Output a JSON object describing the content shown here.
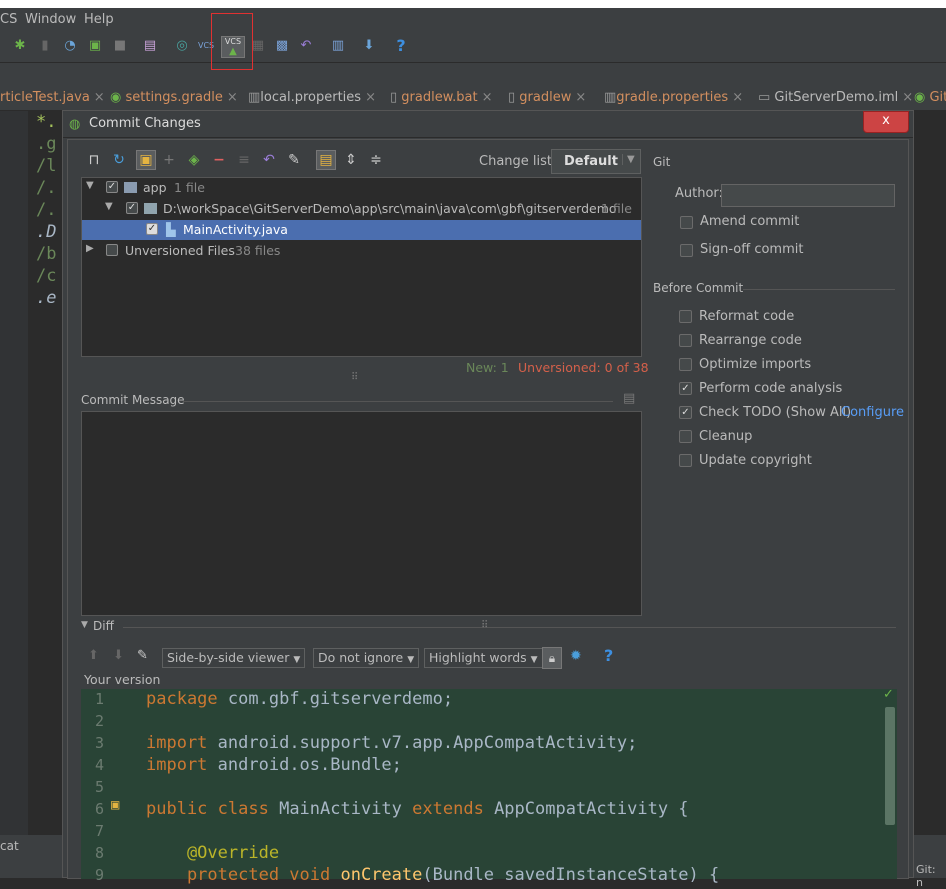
{
  "menu": {
    "items": [
      "CS",
      "Window",
      "Help"
    ]
  },
  "toolbar": {
    "icons": [
      "debug-icon",
      "attach-debugger-icon",
      "coverage-icon",
      "profile-icon",
      "stop-icon",
      "sdk-manager-icon",
      "sync-icon",
      "vcs-update-icon",
      "vcs-commit-icon",
      "project-structure-icon",
      "avd-manager-icon",
      "revert-icon",
      "project-view-icon",
      "android-monitor-icon",
      "help-icon"
    ],
    "vcs_update_text": "VCS",
    "vcs_commit_text": "VCS",
    "help_text": "?"
  },
  "tabs": [
    {
      "label": "rticleTest.java"
    },
    {
      "label": "settings.gradle"
    },
    {
      "label": "local.properties"
    },
    {
      "label": "gradlew.bat"
    },
    {
      "label": "gradlew"
    },
    {
      "label": "gradle.properties"
    },
    {
      "label": "GitServerDemo.iml"
    },
    {
      "label": "Git"
    }
  ],
  "editor_background_lines": [
    "*.",
    ".g",
    "/l",
    "/.",
    "/.",
    ".D",
    "/b",
    "/c",
    ".e"
  ],
  "bottom": {
    "left_label": "cat",
    "right_label": "Git: n"
  },
  "dialog": {
    "title": "Commit Changes",
    "close": "x",
    "change_list_label": "Change list:",
    "change_list_value": "Default",
    "tree": [
      {
        "label": "app",
        "count": "1 file"
      },
      {
        "label": "D:\\workSpace\\GitServerDemo\\app\\src\\main\\java\\com\\gbf\\gitserverdemo",
        "count": "1 file"
      },
      {
        "label": "MainActivity.java",
        "count": ""
      },
      {
        "label": "Unversioned Files",
        "count": "38 files"
      }
    ],
    "status_new": "New: 1",
    "status_unversioned": "Unversioned: 0 of 38",
    "commit_message_label": "Commit Message",
    "git_label": "Git",
    "author_label": "Author:",
    "author_value": "",
    "amend_commit": "Amend commit",
    "signoff_commit": "Sign-off commit",
    "before_commit_label": "Before Commit",
    "before_commit": [
      {
        "label": "Reformat code",
        "checked": false
      },
      {
        "label": "Rearrange code",
        "checked": false
      },
      {
        "label": "Optimize imports",
        "checked": false
      },
      {
        "label": "Perform code analysis",
        "checked": true
      },
      {
        "label": "Check TODO (Show All)",
        "checked": true
      },
      {
        "label": "Cleanup",
        "checked": false
      },
      {
        "label": "Update copyright",
        "checked": false
      }
    ],
    "configure_link": "Configure",
    "diff_label": "Diff",
    "viewer_combo": "Side-by-side viewer",
    "ignore_combo": "Do not ignore",
    "highlight_combo": "Highlight words",
    "help": "?",
    "your_version": "Your version",
    "code_lines": [
      {
        "num": "1",
        "text": "package com.gbf.gitserverdemo;"
      },
      {
        "num": "2",
        "text": ""
      },
      {
        "num": "3",
        "text": "import android.support.v7.app.AppCompatActivity;"
      },
      {
        "num": "4",
        "text": "import android.os.Bundle;"
      },
      {
        "num": "5",
        "text": ""
      },
      {
        "num": "6",
        "text": "public class MainActivity extends AppCompatActivity {"
      },
      {
        "num": "7",
        "text": ""
      },
      {
        "num": "8",
        "text": "    @Override"
      },
      {
        "num": "9",
        "text": "    protected void onCreate(Bundle savedInstanceState) {"
      }
    ]
  }
}
